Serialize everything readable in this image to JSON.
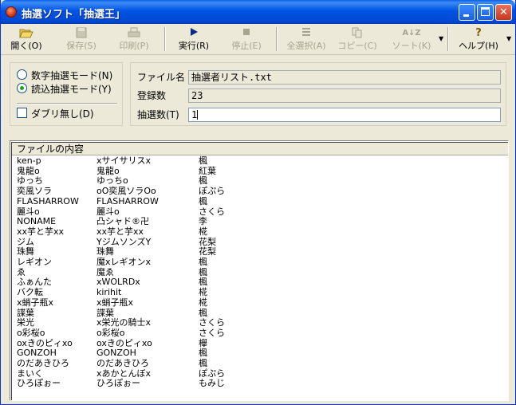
{
  "window": {
    "title": "抽選ソフト「抽選王」"
  },
  "toolbar": {
    "open": "開く(O)",
    "save": "保存(S)",
    "print": "印刷(P)",
    "run": "実行(R)",
    "stop": "停止(E)",
    "select_all": "全選択(A)",
    "copy": "コピー(C)",
    "sort": "ソート(K)",
    "help": "ヘルプ(H)"
  },
  "mode": {
    "numeric_label": "数字抽選モード(N)",
    "import_label": "読込抽選モード(Y)",
    "selected": "import",
    "no_duplicates_label": "ダブリ無し(D)",
    "no_duplicates_checked": false
  },
  "info": {
    "filename_label": "ファイル名",
    "filename_value": "抽選者リスト.txt",
    "count_label": "登録数",
    "count_value": "23",
    "draw_label": "抽選数(T)",
    "draw_value": "1"
  },
  "content": {
    "header": "ファイルの内容",
    "rows": [
      [
        "ken-p",
        "xサイサリスx",
        "楓"
      ],
      [
        "鬼龍o",
        "鬼龍o",
        "紅葉"
      ],
      [
        "ゆっち",
        "ゆっちo",
        "楓"
      ],
      [
        "奕風ソラ",
        "oO奕風ソラOo",
        "ぽぷら"
      ],
      [
        "FLASHARROW",
        "FLASHARROW",
        "楓"
      ],
      [
        "麗斗o",
        "麗斗o",
        "さくら"
      ],
      [
        "NONAME",
        "凸シャド®卍",
        "李"
      ],
      [
        "xx芋と芋xx",
        "xx芋と芋xx",
        "椛"
      ],
      [
        "ジム",
        "YジムソンズY",
        "花梨"
      ],
      [
        "珠舞",
        "珠舞",
        "花梨"
      ],
      [
        "レギオン",
        "魔xレギオンx",
        "楓"
      ],
      [
        "ゑ",
        "魔ゑ",
        "楓"
      ],
      [
        "ふぁんた",
        "xWOLRDx",
        "楓"
      ],
      [
        "バク転",
        "kirihit",
        "椛"
      ],
      [
        "x蛸子瓶x",
        "x蛸子瓶x",
        "椛"
      ],
      [
        "諜葉",
        "諜葉",
        "楓"
      ],
      [
        "栄光",
        "x栄光の騎士x",
        "さくら"
      ],
      [
        "o彩桜o",
        "o彩桜o",
        "さくら"
      ],
      [
        "oxきのピィxo",
        "oxきのピィxo",
        "欅"
      ],
      [
        "GONZOH",
        "GONZOH",
        "楓"
      ],
      [
        "のだあきひろ",
        "のだあきひろ",
        "楓"
      ],
      [
        "まいく",
        "xあかとんぼx",
        "ぽぷら"
      ],
      [
        "ひろぽぉー",
        "ひろぽぉー",
        "もみじ"
      ]
    ]
  }
}
